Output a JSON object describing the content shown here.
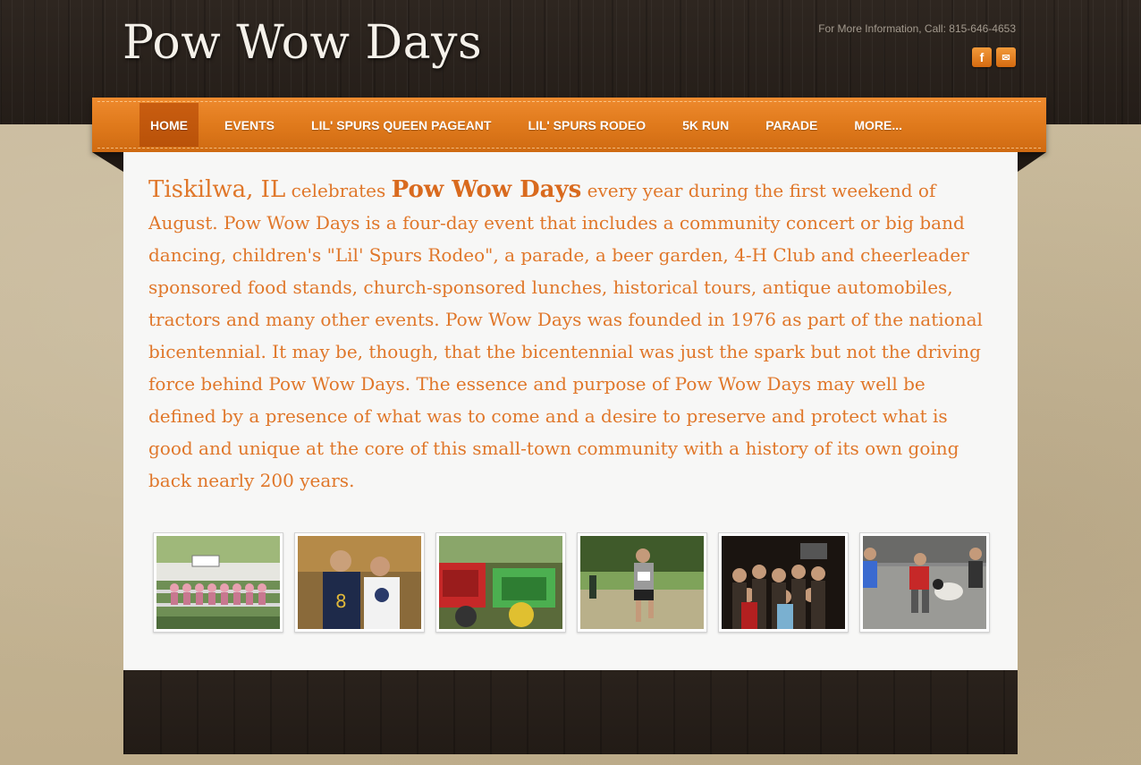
{
  "site": {
    "title": "Pow Wow Days",
    "contact": "For More Information, Call: 815-646-4653",
    "social": [
      {
        "icon": "facebook-icon",
        "glyph": "f"
      },
      {
        "icon": "email-icon",
        "glyph": "✉"
      }
    ]
  },
  "nav": {
    "items": [
      {
        "label": "HOME",
        "active": true
      },
      {
        "label": "EVENTS"
      },
      {
        "label": "LIL' SPURS QUEEN PAGEANT"
      },
      {
        "label": "LIL' SPURS RODEO"
      },
      {
        "label": "5K RUN"
      },
      {
        "label": "PARADE"
      },
      {
        "label": "MORE..."
      }
    ]
  },
  "intro": {
    "location": "Tiskilwa, IL",
    "t1": " celebrates ",
    "brand": "Pow Wow Days",
    "t2": " every year during the first weekend of August. Pow Wow Days is a four-day event that includes a community concert or big band dancing, children's \"Lil' Spurs Rodeo\", a parade, a beer garden, 4-H Club and cheerleader sponsored food stands, church-sponsored lunches, historical tours, antique automobiles, tractors and many other events. Pow Wow Days was founded in 1976 as part of the national bicentennial. It may be, though, that the bicentennial was just the spark but not the driving force behind Pow Wow Days. The essence and purpose of Pow Wow Days may well be defined by a presence of what was to come and a desire to preserve and protect what is good and unique at the core of this small-town community with a history of its own going back nearly 200 years."
  },
  "colors": {
    "accent_orange": "#e07a1c",
    "text_orange": "#e0772a",
    "wood_dark": "#2a221c"
  }
}
